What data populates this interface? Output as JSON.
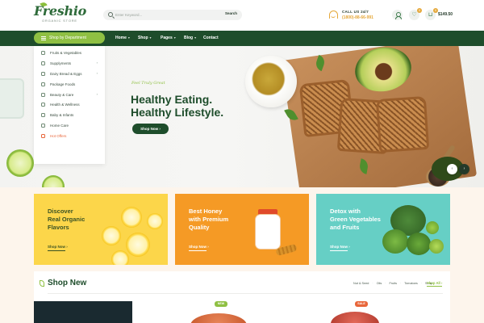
{
  "header": {
    "logo": {
      "wordmark": "Freshio",
      "tagline": "ORGANIC STORE"
    },
    "search": {
      "placeholder": "Enter Keyword...",
      "button": "Search"
    },
    "call_us": {
      "label": "CALL US 24/7",
      "number": "(1800)-88-66-991"
    },
    "wishlist_count": "0",
    "cart_count": "0",
    "cart_total": "$149.50"
  },
  "nav": {
    "departments_button": "Shop by Department",
    "links": [
      {
        "label": "Home",
        "has_dropdown": true
      },
      {
        "label": "Shop",
        "has_dropdown": true
      },
      {
        "label": "Pages",
        "has_dropdown": true
      },
      {
        "label": "Blog",
        "has_dropdown": true
      },
      {
        "label": "Contact",
        "has_dropdown": false
      }
    ]
  },
  "departments": [
    {
      "label": "Fruits & Vegetables",
      "has_submenu": false,
      "hot": false
    },
    {
      "label": "Supplyments",
      "has_submenu": true,
      "hot": false
    },
    {
      "label": "Dairy Bread & Eggs",
      "has_submenu": true,
      "hot": false
    },
    {
      "label": "Package Foods",
      "has_submenu": false,
      "hot": false
    },
    {
      "label": "Beauty & Care",
      "has_submenu": true,
      "hot": false
    },
    {
      "label": "Health & Wellness",
      "has_submenu": false,
      "hot": false
    },
    {
      "label": "Baby & Infants",
      "has_submenu": false,
      "hot": false
    },
    {
      "label": "Home Care",
      "has_submenu": false,
      "hot": false
    },
    {
      "label": "Hot Offers",
      "has_submenu": false,
      "hot": true
    }
  ],
  "hero": {
    "eyebrow": "Feel Truly Great",
    "headline_line1": "Healthy Eating.",
    "headline_line2": "Healthy Lifestyle.",
    "button": "Shop Now",
    "prev_icon": "chevron-left-icon",
    "next_icon": "chevron-right-icon"
  },
  "promos": [
    {
      "title_line1": "Discover",
      "title_line2": "Real Organic",
      "title_line3": "Flavors",
      "link": "Shop Now",
      "bg": "#fcd64a"
    },
    {
      "title_line1": "Best Honey",
      "title_line2": "with Premium",
      "title_line3": "Quality",
      "link": "Shop Now",
      "bg": "#f59a25"
    },
    {
      "title_line1": "Detox with",
      "title_line2": "Green Vegetables",
      "title_line3": "and Fruits",
      "link": "Shop Now",
      "bg": "#66cfc5"
    }
  ],
  "shop_new": {
    "title": "Shop New",
    "tabs": [
      "Nut & Seed",
      "Oils",
      "Fruits",
      "Tomatoes",
      "Soup"
    ],
    "view_all": "Shop All",
    "tags": {
      "new": "NEW",
      "sale": "SALE"
    }
  },
  "colors": {
    "brand_dark_green": "#1e4d2b",
    "brand_light_green": "#8fc043",
    "accent_orange": "#e5a83a",
    "hot_offer": "#e8663a"
  }
}
